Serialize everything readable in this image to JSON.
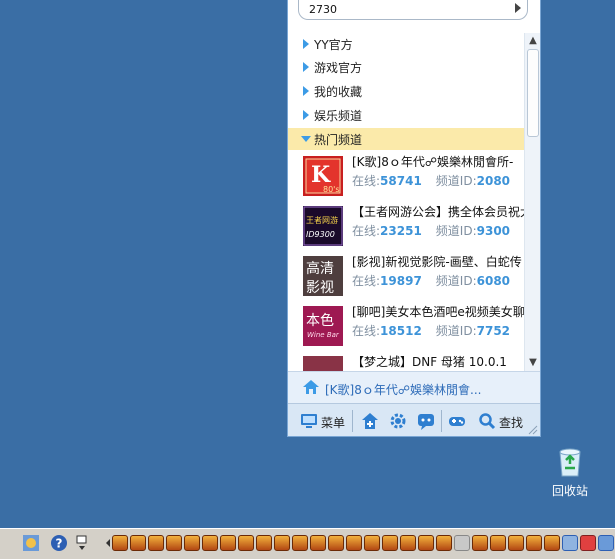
{
  "search": {
    "value": "2730"
  },
  "categories": [
    {
      "label": "YY官方"
    },
    {
      "label": "游戏官方"
    },
    {
      "label": "我的收藏"
    },
    {
      "label": "娱乐频道"
    },
    {
      "label": "热门频道",
      "expanded": true
    }
  ],
  "channels": [
    {
      "title": "[K歌]8ｏ年代☍娛樂林閒會所-",
      "online_label": "在线:",
      "online": "58741",
      "id_label": "频道ID:",
      "id": "2080",
      "thumb_text": "K",
      "thumb_sub": "80's"
    },
    {
      "title": "【王者网游公会】携全体会员祝大",
      "online_label": "在线:",
      "online": "23251",
      "id_label": "频道ID:",
      "id": "9300",
      "thumb_text": "王者网游",
      "thumb_sub": "ID9300"
    },
    {
      "title": "[影视]新视觉影院-画壁、白蛇传",
      "online_label": "在线:",
      "online": "19897",
      "id_label": "频道ID:",
      "id": "6080",
      "thumb_text": "高清",
      "thumb_sub": "影视"
    },
    {
      "title": "[聊吧]美女本色酒吧e视频美女聊",
      "online_label": "在线:",
      "online": "18512",
      "id_label": "频道ID:",
      "id": "7752",
      "thumb_text": "本色",
      "thumb_sub": "Wine Bar"
    },
    {
      "title": "【梦之城】DNF 母猪 10.0.1",
      "online_label": "",
      "online": "",
      "id_label": "",
      "id": "",
      "thumb_text": "",
      "thumb_sub": ""
    }
  ],
  "recent": {
    "text": "[K歌]8ｏ年代☍娛樂林閒會..."
  },
  "toolbar": {
    "menu_label": "菜单",
    "find_label": "查找"
  },
  "desktop": {
    "recycle_label": "回收站"
  },
  "colors": {
    "desktop": "#3a6ea5",
    "accent": "#3c9be6",
    "highlight": "#fbeaaa"
  }
}
